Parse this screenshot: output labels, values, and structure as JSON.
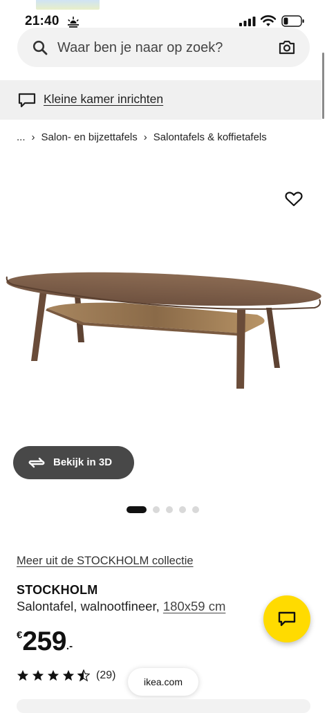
{
  "status_bar": {
    "time": "21:40",
    "icons": [
      "sunrise-icon",
      "signal-icon",
      "wifi-icon",
      "battery-icon"
    ]
  },
  "search": {
    "placeholder": "Waar ben je naar op zoek?",
    "icons": [
      "search-icon",
      "camera-icon"
    ]
  },
  "banner": {
    "label": "Kleine kamer inrichten",
    "icon": "chat-bubble-icon"
  },
  "breadcrumb": {
    "items": [
      "...",
      "Salon- en bijzettafels",
      "Salontafels & koffietafels"
    ]
  },
  "product": {
    "gallery": {
      "view_3d_label": "Bekijk in 3D",
      "slide_count": 5,
      "active_slide": 1
    },
    "collection_link": "Meer uit de STOCKHOLM collectie",
    "name": "STOCKHOLM",
    "description": "Salontafel, walnootfineer,",
    "size": "180x59 cm",
    "price": {
      "currency": "€",
      "amount": "259",
      "cents": ".-"
    },
    "rating": {
      "stars": 4.5,
      "max": 5,
      "count": "(29)"
    }
  },
  "browser": {
    "url": "ikea.com"
  },
  "colors": {
    "accent_yellow": "#ffdb00",
    "button_dark": "#484848",
    "surface_grey": "#f0f0f0",
    "wood": "#7a5a44"
  }
}
